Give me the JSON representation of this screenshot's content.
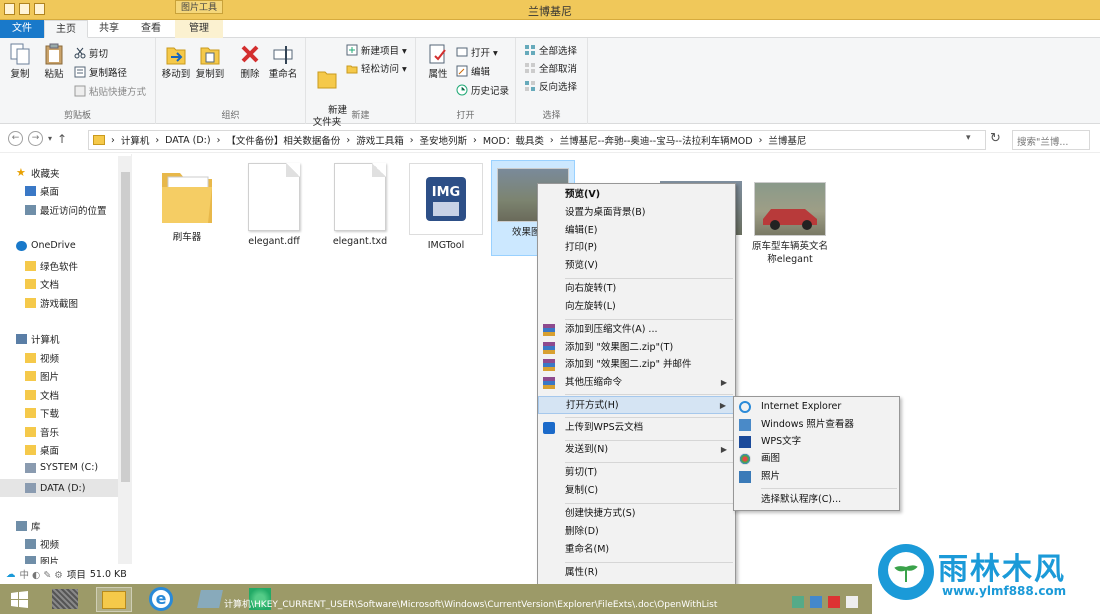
{
  "window": {
    "title": "兰博基尼",
    "context_tab": "图片工具"
  },
  "tabs": {
    "file": "文件",
    "home": "主页",
    "share": "共享",
    "view": "查看",
    "manage": "管理"
  },
  "ribbon": {
    "clipboard": {
      "label": "剪贴板",
      "copy": "复制",
      "paste": "粘贴",
      "cut": "剪切",
      "copy_path": "复制路径",
      "paste_shortcut": "粘贴快捷方式"
    },
    "organize": {
      "label": "组织",
      "move_to": "移动到",
      "copy_to": "复制到",
      "delete": "删除",
      "rename": "重命名"
    },
    "new": {
      "label": "新建",
      "new_folder": "新建\n文件夹",
      "new_item": "新建项目 ▾",
      "easy_access": "轻松访问 ▾"
    },
    "open": {
      "label": "打开",
      "properties": "属性",
      "open": "打开 ▾",
      "edit": "编辑",
      "history": "历史记录"
    },
    "select": {
      "label": "选择",
      "select_all": "全部选择",
      "select_none": "全部取消",
      "invert": "反向选择"
    }
  },
  "address": {
    "crumbs": [
      "计算机",
      "DATA (D:)",
      "【文件备份】相关数据备份",
      "游戏工具箱",
      "圣安地列斯",
      "MOD：载具类",
      "兰博基尼--奔驰--奥迪--宝马--法拉利车辆MOD",
      "兰博基尼"
    ],
    "search_placeholder": "搜索\"兰博..."
  },
  "nav": {
    "favorites": "收藏夹",
    "desktop": "桌面",
    "recent": "最近访问的位置",
    "onedrive": "OneDrive",
    "green_software": "绿色软件",
    "documents": "文档",
    "game_screens": "游戏截图",
    "computer": "计算机",
    "videos": "视频",
    "pictures": "图片",
    "docs2": "文档",
    "downloads": "下载",
    "music": "音乐",
    "desktop2": "桌面",
    "system_c": "SYSTEM (C:)",
    "data_d": "DATA (D:)",
    "library": "库",
    "lib_videos": "视频",
    "lib_pictures": "图片"
  },
  "files": [
    {
      "name": "刷车器",
      "kind": "folder"
    },
    {
      "name": "elegant.dff",
      "kind": "doc"
    },
    {
      "name": "elegant.txd",
      "kind": "doc"
    },
    {
      "name": "IMGTool",
      "kind": "app"
    },
    {
      "name": "效果图二",
      "kind": "photo"
    },
    {
      "name": "原车型车辆英文名称elegant",
      "kind": "photo"
    }
  ],
  "status": {
    "items": "项目",
    "size": "51.0 KB"
  },
  "context_menu": {
    "preview": "预览(V)",
    "set_wallpaper": "设置为桌面背景(B)",
    "edit": "编辑(E)",
    "print": "打印(P)",
    "preview2": "预览(V)",
    "rotate_right": "向右旋转(T)",
    "rotate_left": "向左旋转(L)",
    "add_archive": "添加到压缩文件(A) ...",
    "add_zip": "添加到 \"效果图二.zip\"(T)",
    "add_zip_mail": "添加到 \"效果图二.zip\" 并邮件",
    "more_compress": "其他压缩命令",
    "open_with": "打开方式(H)",
    "upload_wps": "上传到WPS云文档",
    "send_to": "发送到(N)",
    "cut": "剪切(T)",
    "copy": "复制(C)",
    "create_shortcut": "创建快捷方式(S)",
    "delete": "删除(D)",
    "rename": "重命名(M)",
    "properties": "属性(R)"
  },
  "submenu": {
    "ie": "Internet Explorer",
    "photo_viewer": "Windows 照片查看器",
    "wps": "WPS文字",
    "paint": "画图",
    "photos": "照片",
    "choose_default": "选择默认程序(C)..."
  },
  "taskbar": {
    "reg_path": "计算机\\HKEY_CURRENT_USER\\Software\\Microsoft\\Windows\\CurrentVersion\\Explorer\\FileExts\\.doc\\OpenWithList"
  },
  "watermark": {
    "brand": "雨林木风",
    "url": "www.ylmf888.com"
  },
  "colors": {
    "title_bar": "#f0c85a",
    "file_tab": "#1979ca",
    "highlight": "#d5e4f3",
    "taskbar": "#9c9a68",
    "watermark": "#1b9ad8"
  }
}
